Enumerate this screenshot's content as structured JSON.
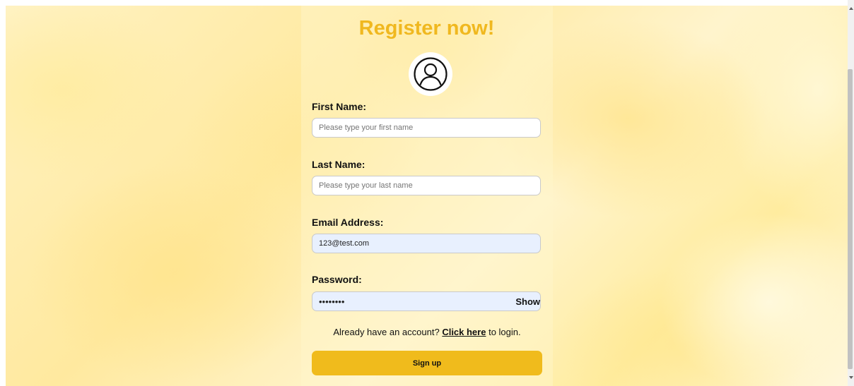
{
  "page": {
    "title": "Register now!",
    "colors": {
      "title": "#f0b81f",
      "button": "#f0bb1c",
      "autofill": "#e8f0fe"
    }
  },
  "form": {
    "avatar_icon": "user-circle-icon",
    "first_name": {
      "label": "First Name:",
      "value": "",
      "placeholder": "Please type your first name"
    },
    "last_name": {
      "label": "Last Name:",
      "value": "",
      "placeholder": "Please type your last name"
    },
    "email": {
      "label": "Email Address:",
      "value": "123@test.com",
      "placeholder": ""
    },
    "password": {
      "label": "Password:",
      "value": "password",
      "show_label": "Show"
    },
    "login_prompt": {
      "before": "Already have an account?",
      "link": "Click here",
      "after": "to login."
    },
    "submit_label": "Sign up"
  }
}
